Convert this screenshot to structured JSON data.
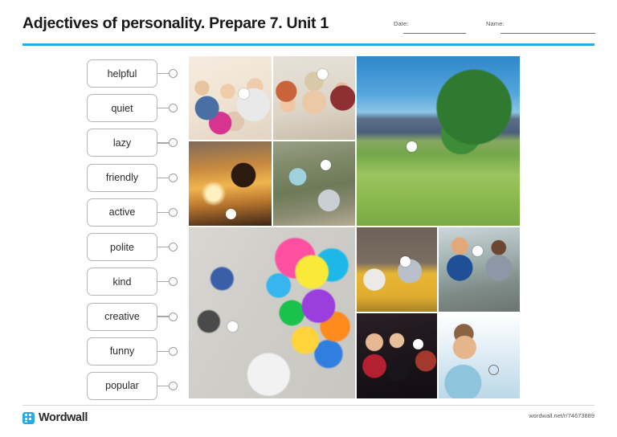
{
  "header": {
    "title": "Adjectives of personality. Prepare 7. Unit 1",
    "date_label": "Date:",
    "name_label": "Name:",
    "date_value": "",
    "name_value": "",
    "accent_color": "#29abe2"
  },
  "words": [
    {
      "label": "helpful"
    },
    {
      "label": "quiet"
    },
    {
      "label": "lazy"
    },
    {
      "label": "friendly"
    },
    {
      "label": "active"
    },
    {
      "label": "polite"
    },
    {
      "label": "kind"
    },
    {
      "label": "creative"
    },
    {
      "label": "funny"
    },
    {
      "label": "popular"
    }
  ],
  "images": [
    {
      "name": "high-five-group",
      "alt": "People giving a high five indoors"
    },
    {
      "name": "funny-faces",
      "alt": "Men making funny faces through a wooden ladder"
    },
    {
      "name": "cycling-couple",
      "alt": "Couple riding bicycles in a green mountain valley"
    },
    {
      "name": "helping-hand",
      "alt": "Hiker pulling up a climber at sunset"
    },
    {
      "name": "forest-helping",
      "alt": "Woman helping a child up in a forest"
    },
    {
      "name": "creative-doodles",
      "alt": "Woman in front of a wall of colourful creative doodles"
    },
    {
      "name": "lazy-on-couch",
      "alt": "Man lying lazily on a yellow couch with a phone"
    },
    {
      "name": "business-handshake",
      "alt": "Two businessmen shaking hands politely"
    },
    {
      "name": "popular-couple",
      "alt": "Popular couple at a party"
    },
    {
      "name": "quiet-boy",
      "alt": "Boy holding a finger to his lips saying shh"
    }
  ],
  "footer": {
    "brand": "Wordwall",
    "url": "wordwall.net/r/74673889"
  }
}
